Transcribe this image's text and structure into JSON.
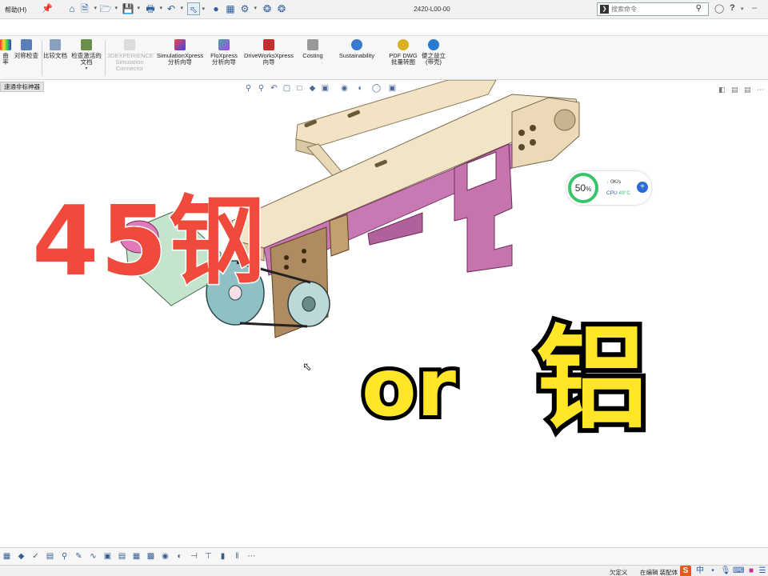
{
  "titlebar": {
    "help_menu": "帮助(H)",
    "doc_title": "2420-L00-00",
    "search_placeholder": "搜索命令"
  },
  "ribbon": {
    "items": [
      {
        "label": "曲率"
      },
      {
        "label": "对称检查"
      },
      {
        "label": "比较文档"
      },
      {
        "label": "检查激活的文档"
      },
      {
        "label": "3DEXPERIENCE Simulation Connector"
      },
      {
        "label": "SimulationXpress 分析向导"
      },
      {
        "label": "FloXpress 分析向导"
      },
      {
        "label": "DriveWorksXpress 向导"
      },
      {
        "label": "Costing"
      },
      {
        "label": "Sustainability"
      },
      {
        "label": "PDF DWG 批量转图"
      },
      {
        "label": "便之益立(带壳)"
      }
    ]
  },
  "tab_tag": "速通非标神器",
  "overlay": {
    "steel": "45钢",
    "or": "or",
    "aluminum": "铝"
  },
  "cpu_widget": {
    "percent": "50",
    "percent_unit": "%",
    "net_speed": "0K/s",
    "cpu_label": "CPU",
    "cpu_temp": "49°C"
  },
  "statusbar": {
    "custom": "欠定义",
    "editing": "在编辑 装配体",
    "ime_lang": "中"
  },
  "colors": {
    "steel_red": "#f04a3c",
    "alu_yellow": "#ffe629",
    "frame_beige": "#efe0c0",
    "bracket_pink": "#d07ab0",
    "motor_green": "#b8e0c0"
  }
}
